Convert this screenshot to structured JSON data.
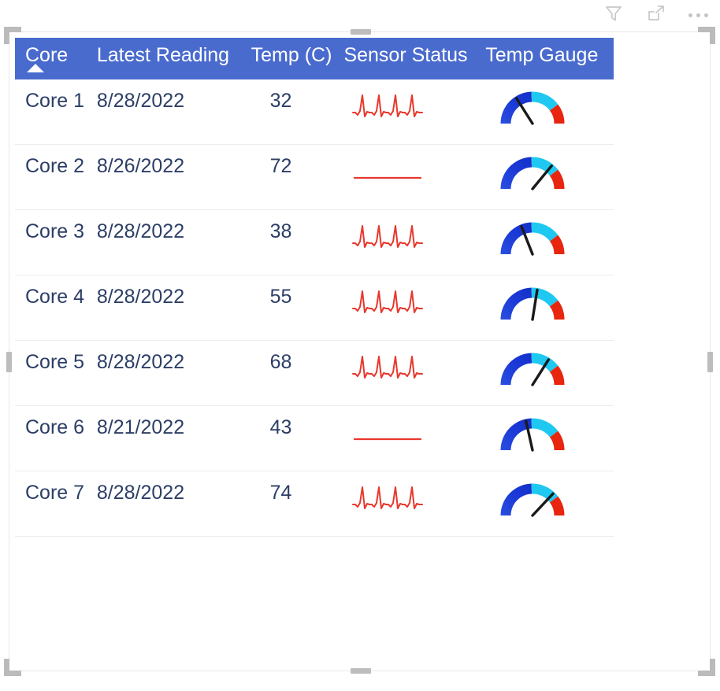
{
  "visual_header": {
    "icons": [
      {
        "name": "filter-icon",
        "label": "Filters"
      },
      {
        "name": "focus-mode-icon",
        "label": "Focus mode"
      },
      {
        "name": "more-options-icon",
        "label": "More options"
      }
    ]
  },
  "table": {
    "sort": {
      "column": "Core",
      "direction": "ascending",
      "glyph": "sort-ascending-icon"
    },
    "header_color": "#4a6bce",
    "header_text_color": "#ffffff",
    "row_text_color": "#2c3e66",
    "sparkline_color": "#e8372c",
    "gauge_colors": {
      "cold": "#1a39d6",
      "mid": "#1fc8f0",
      "hot": "#e8250f",
      "needle": "#1a1a1a"
    },
    "columns": [
      {
        "key": "core",
        "label": "Core"
      },
      {
        "key": "date",
        "label": "Latest Reading"
      },
      {
        "key": "temp",
        "label": "Temp (C)"
      },
      {
        "key": "status",
        "label": "Sensor Status"
      },
      {
        "key": "gauge",
        "label": "Temp Gauge"
      }
    ],
    "rows": [
      {
        "core": "Core 1",
        "date": "8/28/2022",
        "temp": "32",
        "status_type": "heartbeat",
        "gauge_value": 32
      },
      {
        "core": "Core 2",
        "date": "8/26/2022",
        "temp": "72",
        "status_type": "flatline",
        "gauge_value": 72
      },
      {
        "core": "Core 3",
        "date": "8/28/2022",
        "temp": "38",
        "status_type": "heartbeat",
        "gauge_value": 38
      },
      {
        "core": "Core 4",
        "date": "8/28/2022",
        "temp": "55",
        "status_type": "heartbeat",
        "gauge_value": 55
      },
      {
        "core": "Core 5",
        "date": "8/28/2022",
        "temp": "68",
        "status_type": "heartbeat",
        "gauge_value": 68
      },
      {
        "core": "Core 6",
        "date": "8/21/2022",
        "temp": "43",
        "status_type": "flatline",
        "gauge_value": 43
      },
      {
        "core": "Core 7",
        "date": "8/28/2022",
        "temp": "74",
        "status_type": "heartbeat",
        "gauge_value": 74
      }
    ],
    "gauge_scale": {
      "min": 0,
      "max": 100
    }
  }
}
